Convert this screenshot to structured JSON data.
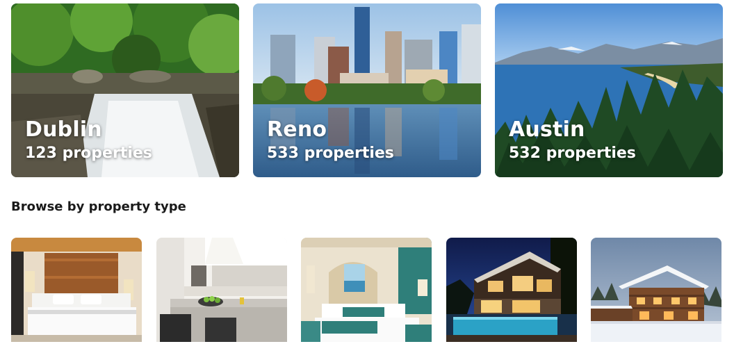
{
  "cities": [
    {
      "name": "Dublin",
      "count": "123 properties"
    },
    {
      "name": "Reno",
      "count": "533 properties"
    },
    {
      "name": "Austin",
      "count": "532 properties"
    }
  ],
  "browse_section": {
    "title": "Browse by property type"
  },
  "property_types": [
    {
      "image": "hotel-room-photo"
    },
    {
      "image": "apartment-kitchen-photo"
    },
    {
      "image": "resort-suite-photo"
    },
    {
      "image": "villa-pool-photo"
    },
    {
      "image": "chalet-snow-photo"
    }
  ]
}
